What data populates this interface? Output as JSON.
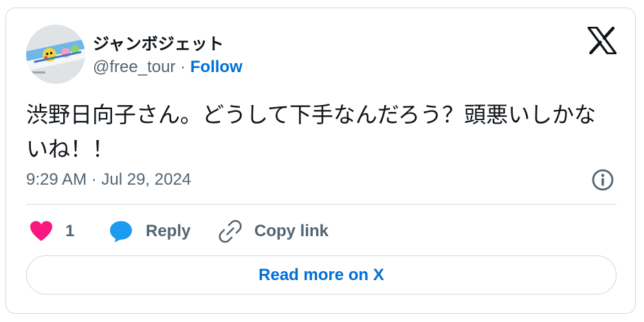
{
  "author": {
    "display_name": "ジャンボジェット",
    "handle": "@free_tour",
    "separator": " · ",
    "follow_label": "Follow"
  },
  "tweet": {
    "text": "渋野日向子さん。どうして下手なんだろう？頭悪いしかないね！！",
    "timestamp": "9:29 AM · Jul 29, 2024"
  },
  "actions": {
    "like_count": "1",
    "reply_label": "Reply",
    "copy_link_label": "Copy link"
  },
  "read_more_label": "Read more on X",
  "icons": {
    "brand": "x-logo-icon",
    "info": "info-icon",
    "like": "heart-icon",
    "reply": "speech-bubble-icon",
    "copy": "link-icon"
  },
  "colors": {
    "heart": "#f91880",
    "reply": "#1d9bf0",
    "link": "#006fd6",
    "text": "#0f1419",
    "secondary": "#536471",
    "border": "#cfd9de"
  }
}
